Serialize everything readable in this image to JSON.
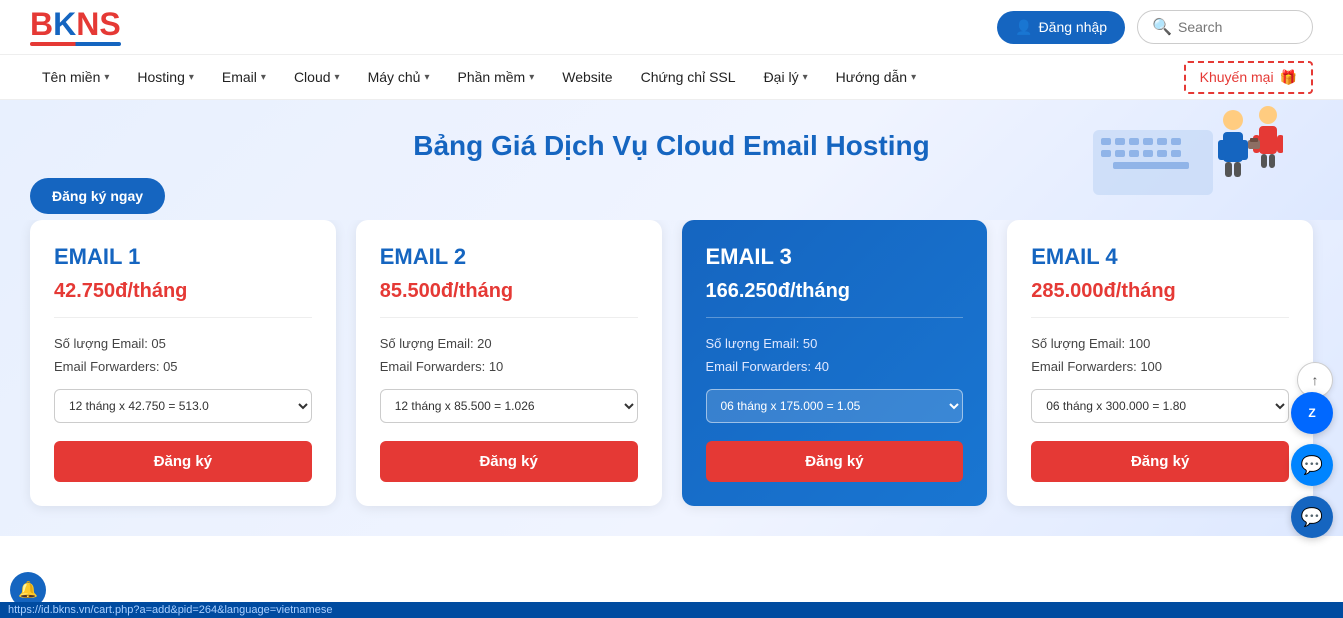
{
  "header": {
    "logo": {
      "letters": [
        "B",
        "K",
        "N",
        "S"
      ]
    },
    "login_label": "Đăng nhập",
    "search_placeholder": "Search"
  },
  "navbar": {
    "items": [
      {
        "label": "Tên miền",
        "has_arrow": true
      },
      {
        "label": "Hosting",
        "has_arrow": true
      },
      {
        "label": "Email",
        "has_arrow": true
      },
      {
        "label": "Cloud",
        "has_arrow": true
      },
      {
        "label": "Máy chủ",
        "has_arrow": true
      },
      {
        "label": "Phần mềm",
        "has_arrow": true
      },
      {
        "label": "Website",
        "has_arrow": false
      },
      {
        "label": "Chứng chỉ SSL",
        "has_arrow": false
      },
      {
        "label": "Đại lý",
        "has_arrow": true
      },
      {
        "label": "Hướng dẫn",
        "has_arrow": true
      }
    ],
    "promo_label": "Khuyến mại"
  },
  "hero": {
    "title": "Bảng Giá Dịch Vụ Cloud Email Hosting",
    "cta_label": "Đăng ký ngay"
  },
  "pricing": {
    "cards": [
      {
        "id": "email1",
        "title": "EMAIL 1",
        "price": "42.750đ/tháng",
        "features": [
          "Số lượng Email: 05",
          "Email Forwarders: 05"
        ],
        "select_value": "12 tháng x 42.750 = 513.0",
        "btn_label": "Đăng ký",
        "featured": false
      },
      {
        "id": "email2",
        "title": "EMAIL 2",
        "price": "85.500đ/tháng",
        "features": [
          "Số lượng Email: 20",
          "Email Forwarders: 10"
        ],
        "select_value": "12 tháng x 85.500 = 1.026",
        "btn_label": "Đăng ký",
        "featured": false
      },
      {
        "id": "email3",
        "title": "EMAIL 3",
        "price": "166.250đ/tháng",
        "features": [
          "Số lượng Email: 50",
          "Email Forwarders: 40"
        ],
        "select_value": "06 tháng x 175.000 = 1.05",
        "btn_label": "Đăng ký",
        "featured": true
      },
      {
        "id": "email4",
        "title": "EMAIL 4",
        "price": "285.000đ/tháng",
        "features": [
          "Số lượng Email: 100",
          "Email Forwarders: 100"
        ],
        "select_value": "06 tháng x 300.000 = 1.80",
        "btn_label": "Đăng ký",
        "featured": false
      }
    ]
  },
  "status_bar": {
    "url": "https://id.bkns.vn/cart.php?a=add&pid=264&language=vietnamese"
  },
  "float_buttons": {
    "zalo_label": "Zalo",
    "messenger_label": "Messenger",
    "chat_label": "Chat"
  }
}
